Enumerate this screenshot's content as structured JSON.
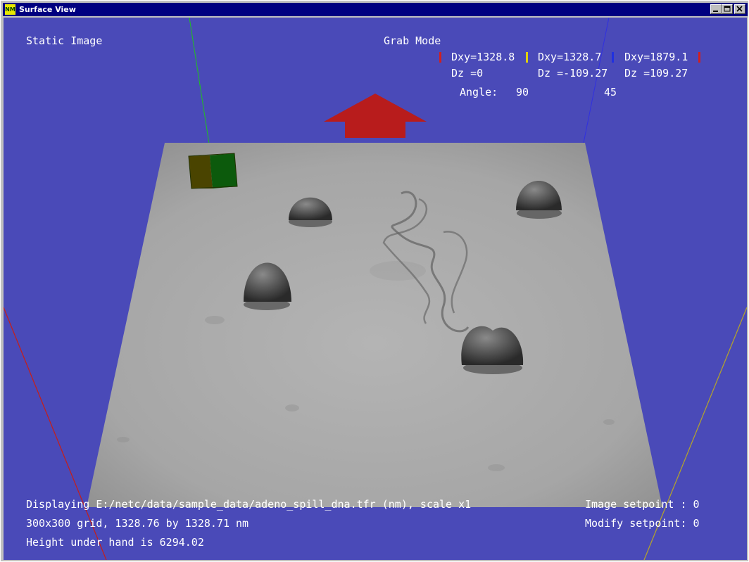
{
  "window": {
    "title": "Surface View",
    "icon_text": "NM"
  },
  "hud": {
    "static_image": "Static Image",
    "grab_mode": "Grab Mode",
    "measure": {
      "dxy": [
        "Dxy=1328.8",
        "Dxy=1328.7",
        "Dxy=1879.1"
      ],
      "dz": [
        "Dz =0",
        "Dz =-109.27",
        "Dz =109.27"
      ],
      "angle_label": "Angle:",
      "angle_1": "90",
      "angle_2": "45"
    },
    "status": {
      "displaying": "Displaying E:/netc/data/sample_data/adeno_spill_dna.tfr (nm), scale x1",
      "grid": "300x300 grid, 1328.76 by 1328.71 nm",
      "height": "Height under hand is 6294.02",
      "image_setpoint": "Image setpoint : 0",
      "modify_setpoint": "Modify setpoint: 0"
    }
  },
  "colors": {
    "background": "#4a4ab8",
    "surface": "#a9a9a9",
    "arrow": "#b81c1c",
    "marker_red": "#d02020",
    "marker_yellow": "#e0d000",
    "marker_blue": "#2030e0"
  }
}
